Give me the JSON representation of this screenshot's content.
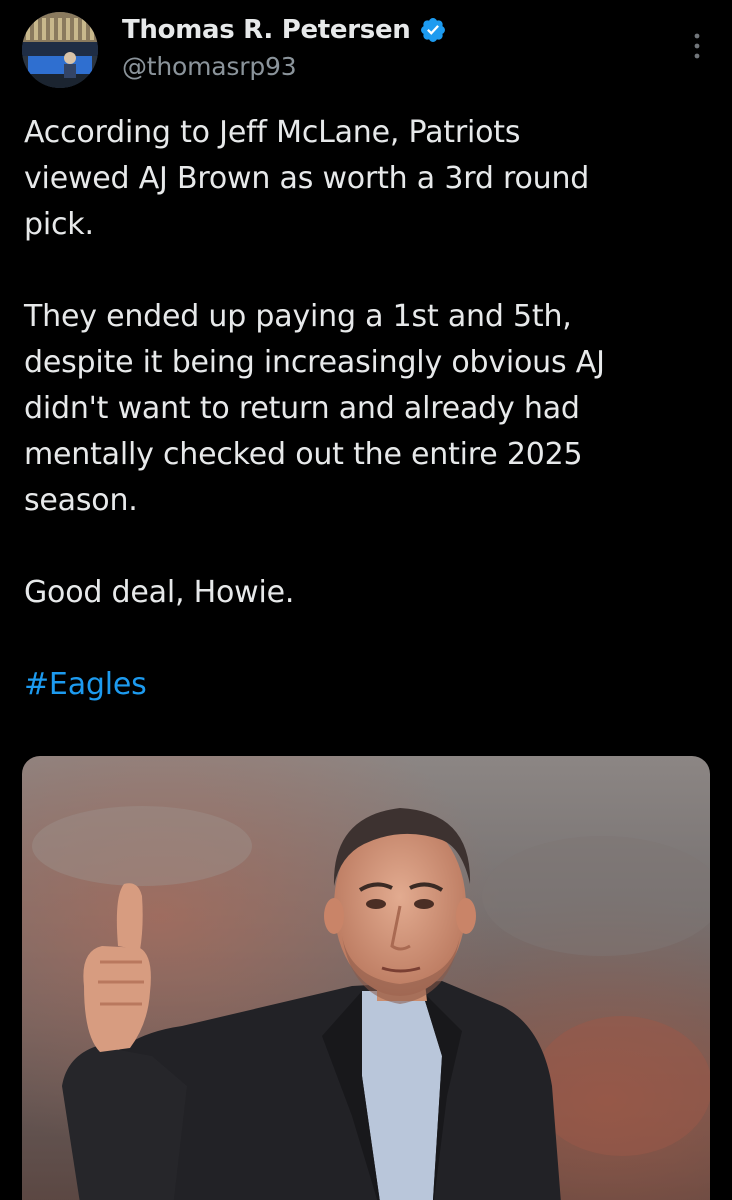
{
  "tweet": {
    "author": {
      "display_name": "Thomas R. Petersen",
      "handle": "@thomasrp93",
      "verified_icon": "verified-badge-icon",
      "verified_color": "#1d9bf0"
    },
    "body": {
      "paragraph_1": "According to Jeff McLane, Patriots\nviewed AJ Brown as worth a 3rd round\npick.",
      "paragraph_2": "They ended up paying a 1st and 5th,\ndespite it being increasingly obvious AJ\ndidn't want to return and already had\nmentally checked out the entire 2025\nseason.",
      "paragraph_3": "Good deal, Howie.",
      "hashtag": "#Eagles"
    },
    "more_icon": "vertical-ellipsis-icon",
    "media": {
      "type": "photo",
      "subject": "man in dark suit giving thumbs up in stadium"
    }
  },
  "colors": {
    "background": "#000000",
    "text": "#e7e9ea",
    "secondary_text": "#8b949b",
    "link": "#1d9bf0"
  }
}
